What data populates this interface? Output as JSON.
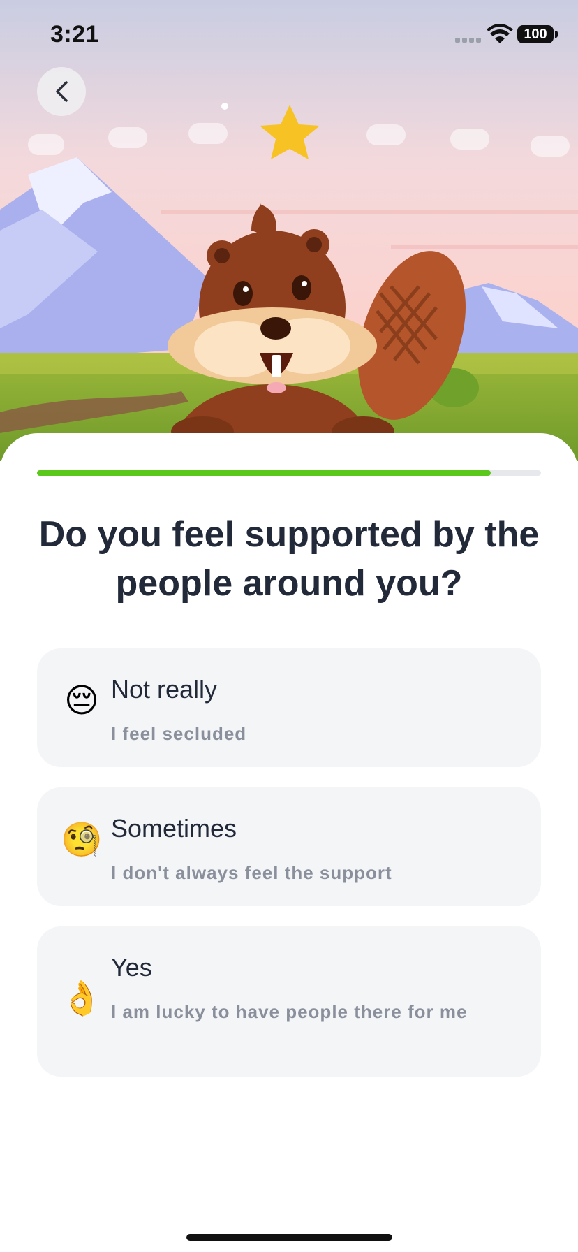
{
  "status_bar": {
    "time": "3:21",
    "battery": "100"
  },
  "back_button": {
    "icon": "chevron-left-icon"
  },
  "progress": {
    "fraction": 0.9
  },
  "question": "Do you feel supported by the people around you?",
  "options": [
    {
      "emoji": "😔",
      "title": "Not really",
      "subtitle": "I feel secluded"
    },
    {
      "emoji": "🧐",
      "title": "Sometimes",
      "subtitle": "I don't always feel the support"
    },
    {
      "emoji": "👌",
      "title": "Yes",
      "subtitle": "I am lucky to have people there for me"
    }
  ],
  "colors": {
    "accent": "#5ac81a",
    "card": "#f4f5f7",
    "text": "#222a3a",
    "subtext": "#8a8f9c"
  }
}
